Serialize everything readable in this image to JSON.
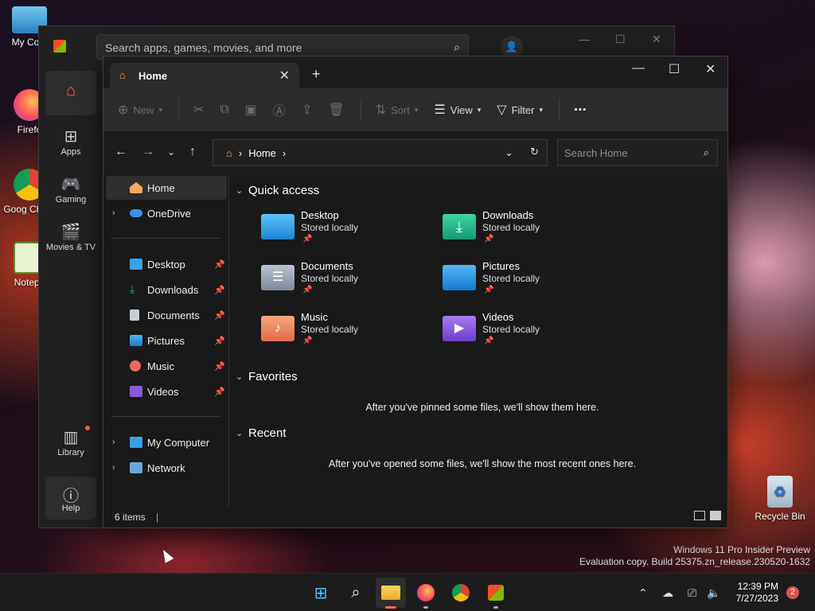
{
  "desktop": {
    "icons": [
      {
        "label": "My Com",
        "icon": "monitor-icon"
      },
      {
        "label": "Firefo",
        "icon": "firefox-icon"
      },
      {
        "label": "Goog Chron",
        "icon": "chrome-icon"
      },
      {
        "label": "Notepa",
        "icon": "notepad-icon"
      }
    ],
    "recycle_bin": "Recycle Bin",
    "watermark_line1": "Windows 11 Pro Insider Preview",
    "watermark_line2": "Evaluation copy. Build 25375.zn_release.230520-1632"
  },
  "store": {
    "search_placeholder": "Search apps, games, movies, and more",
    "nav": [
      {
        "label": "",
        "icon": "home-icon"
      },
      {
        "label": "Apps",
        "icon": "apps-icon"
      },
      {
        "label": "Gaming",
        "icon": "gamepad-icon"
      },
      {
        "label": "Movies & TV",
        "icon": "film-icon"
      },
      {
        "label": "Library",
        "icon": "library-icon"
      },
      {
        "label": "Help",
        "icon": "help-icon"
      }
    ]
  },
  "explorer": {
    "tab_title": "Home",
    "toolbar": {
      "new": "New",
      "sort": "Sort",
      "view": "View",
      "filter": "Filter",
      "more": "⋯"
    },
    "address": {
      "crumb": "Home"
    },
    "search_placeholder": "Search Home",
    "navpane": {
      "home": "Home",
      "onedrive": "OneDrive",
      "desktop": "Desktop",
      "downloads": "Downloads",
      "documents": "Documents",
      "pictures": "Pictures",
      "music": "Music",
      "videos": "Videos",
      "mycomputer": "My Computer",
      "network": "Network"
    },
    "sections": {
      "quick_access": "Quick access",
      "favorites": "Favorites",
      "recent": "Recent"
    },
    "quick_access": [
      {
        "name": "Desktop",
        "sub": "Stored locally"
      },
      {
        "name": "Downloads",
        "sub": "Stored locally"
      },
      {
        "name": "Documents",
        "sub": "Stored locally"
      },
      {
        "name": "Pictures",
        "sub": "Stored locally"
      },
      {
        "name": "Music",
        "sub": "Stored locally"
      },
      {
        "name": "Videos",
        "sub": "Stored locally"
      }
    ],
    "favorites_empty": "After you've pinned some files, we'll show them here.",
    "recent_empty": "After you've opened some files, we'll show the most recent ones here.",
    "status": "6 items"
  },
  "taskbar": {
    "time": "12:39 PM",
    "date": "7/27/2023",
    "notifications": "2"
  },
  "colors": {
    "accent": "#0078d4",
    "store_home": "#f26b5b",
    "folder_blue": "#3aa0e8",
    "folder_teal": "#1fb78a"
  }
}
